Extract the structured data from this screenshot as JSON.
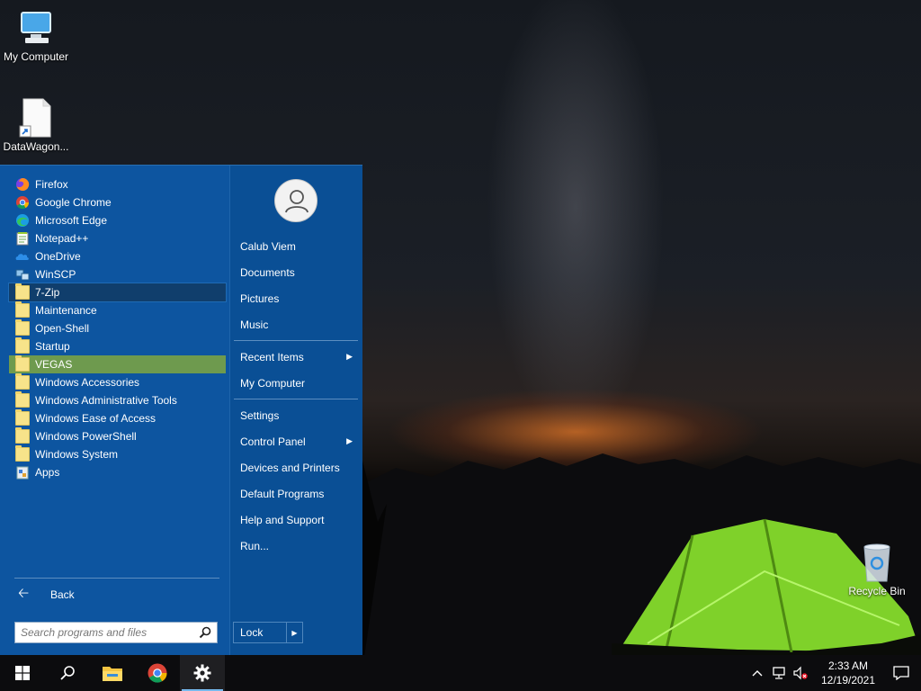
{
  "desktop": {
    "icons": [
      {
        "label": "My Computer",
        "icon": "computer-icon"
      },
      {
        "label": "DataWagon...",
        "icon": "file-shortcut-icon"
      },
      {
        "label": "Recycle Bin",
        "icon": "recycle-bin-icon"
      }
    ]
  },
  "start_menu": {
    "programs": [
      {
        "label": "Firefox",
        "icon": "firefox-icon"
      },
      {
        "label": "Google Chrome",
        "icon": "chrome-icon"
      },
      {
        "label": "Microsoft Edge",
        "icon": "edge-icon"
      },
      {
        "label": "Notepad++",
        "icon": "notepad-plus-icon"
      },
      {
        "label": "OneDrive",
        "icon": "onedrive-icon"
      },
      {
        "label": "WinSCP",
        "icon": "winscp-icon"
      },
      {
        "label": "7-Zip",
        "icon": "folder-icon"
      },
      {
        "label": "Maintenance",
        "icon": "folder-icon"
      },
      {
        "label": "Open-Shell",
        "icon": "folder-icon"
      },
      {
        "label": "Startup",
        "icon": "folder-icon"
      },
      {
        "label": "VEGAS",
        "icon": "folder-icon"
      },
      {
        "label": "Windows Accessories",
        "icon": "folder-icon"
      },
      {
        "label": "Windows Administrative Tools",
        "icon": "folder-icon"
      },
      {
        "label": "Windows Ease of Access",
        "icon": "folder-icon"
      },
      {
        "label": "Windows PowerShell",
        "icon": "folder-icon"
      },
      {
        "label": "Windows System",
        "icon": "folder-icon"
      },
      {
        "label": "Apps",
        "icon": "apps-icon"
      }
    ],
    "back_label": "Back",
    "search_placeholder": "Search programs and files",
    "user_name": "Calub Viem",
    "right_items": [
      {
        "label": "Calub Viem",
        "has_submenu": false
      },
      {
        "label": "Documents",
        "has_submenu": false
      },
      {
        "label": "Pictures",
        "has_submenu": false
      },
      {
        "label": "Music",
        "has_submenu": false
      },
      {
        "label": "Recent Items",
        "has_submenu": true
      },
      {
        "label": "My Computer",
        "has_submenu": false
      },
      {
        "label": "Settings",
        "has_submenu": false
      },
      {
        "label": "Control Panel",
        "has_submenu": true
      },
      {
        "label": "Devices and Printers",
        "has_submenu": false
      },
      {
        "label": "Default Programs",
        "has_submenu": false
      },
      {
        "label": "Help and Support",
        "has_submenu": false
      },
      {
        "label": "Run...",
        "has_submenu": false
      }
    ],
    "lock_label": "Lock",
    "colors": {
      "menu": "#0d55a0",
      "hover": "#6e9a4e",
      "selected": "#103e6c"
    }
  },
  "taskbar": {
    "buttons": [
      "windows-start-icon",
      "search-icon",
      "file-explorer-icon",
      "chrome-icon",
      "settings-gear-icon"
    ],
    "clock_time": "2:33 AM",
    "clock_date": "12/19/2021"
  }
}
